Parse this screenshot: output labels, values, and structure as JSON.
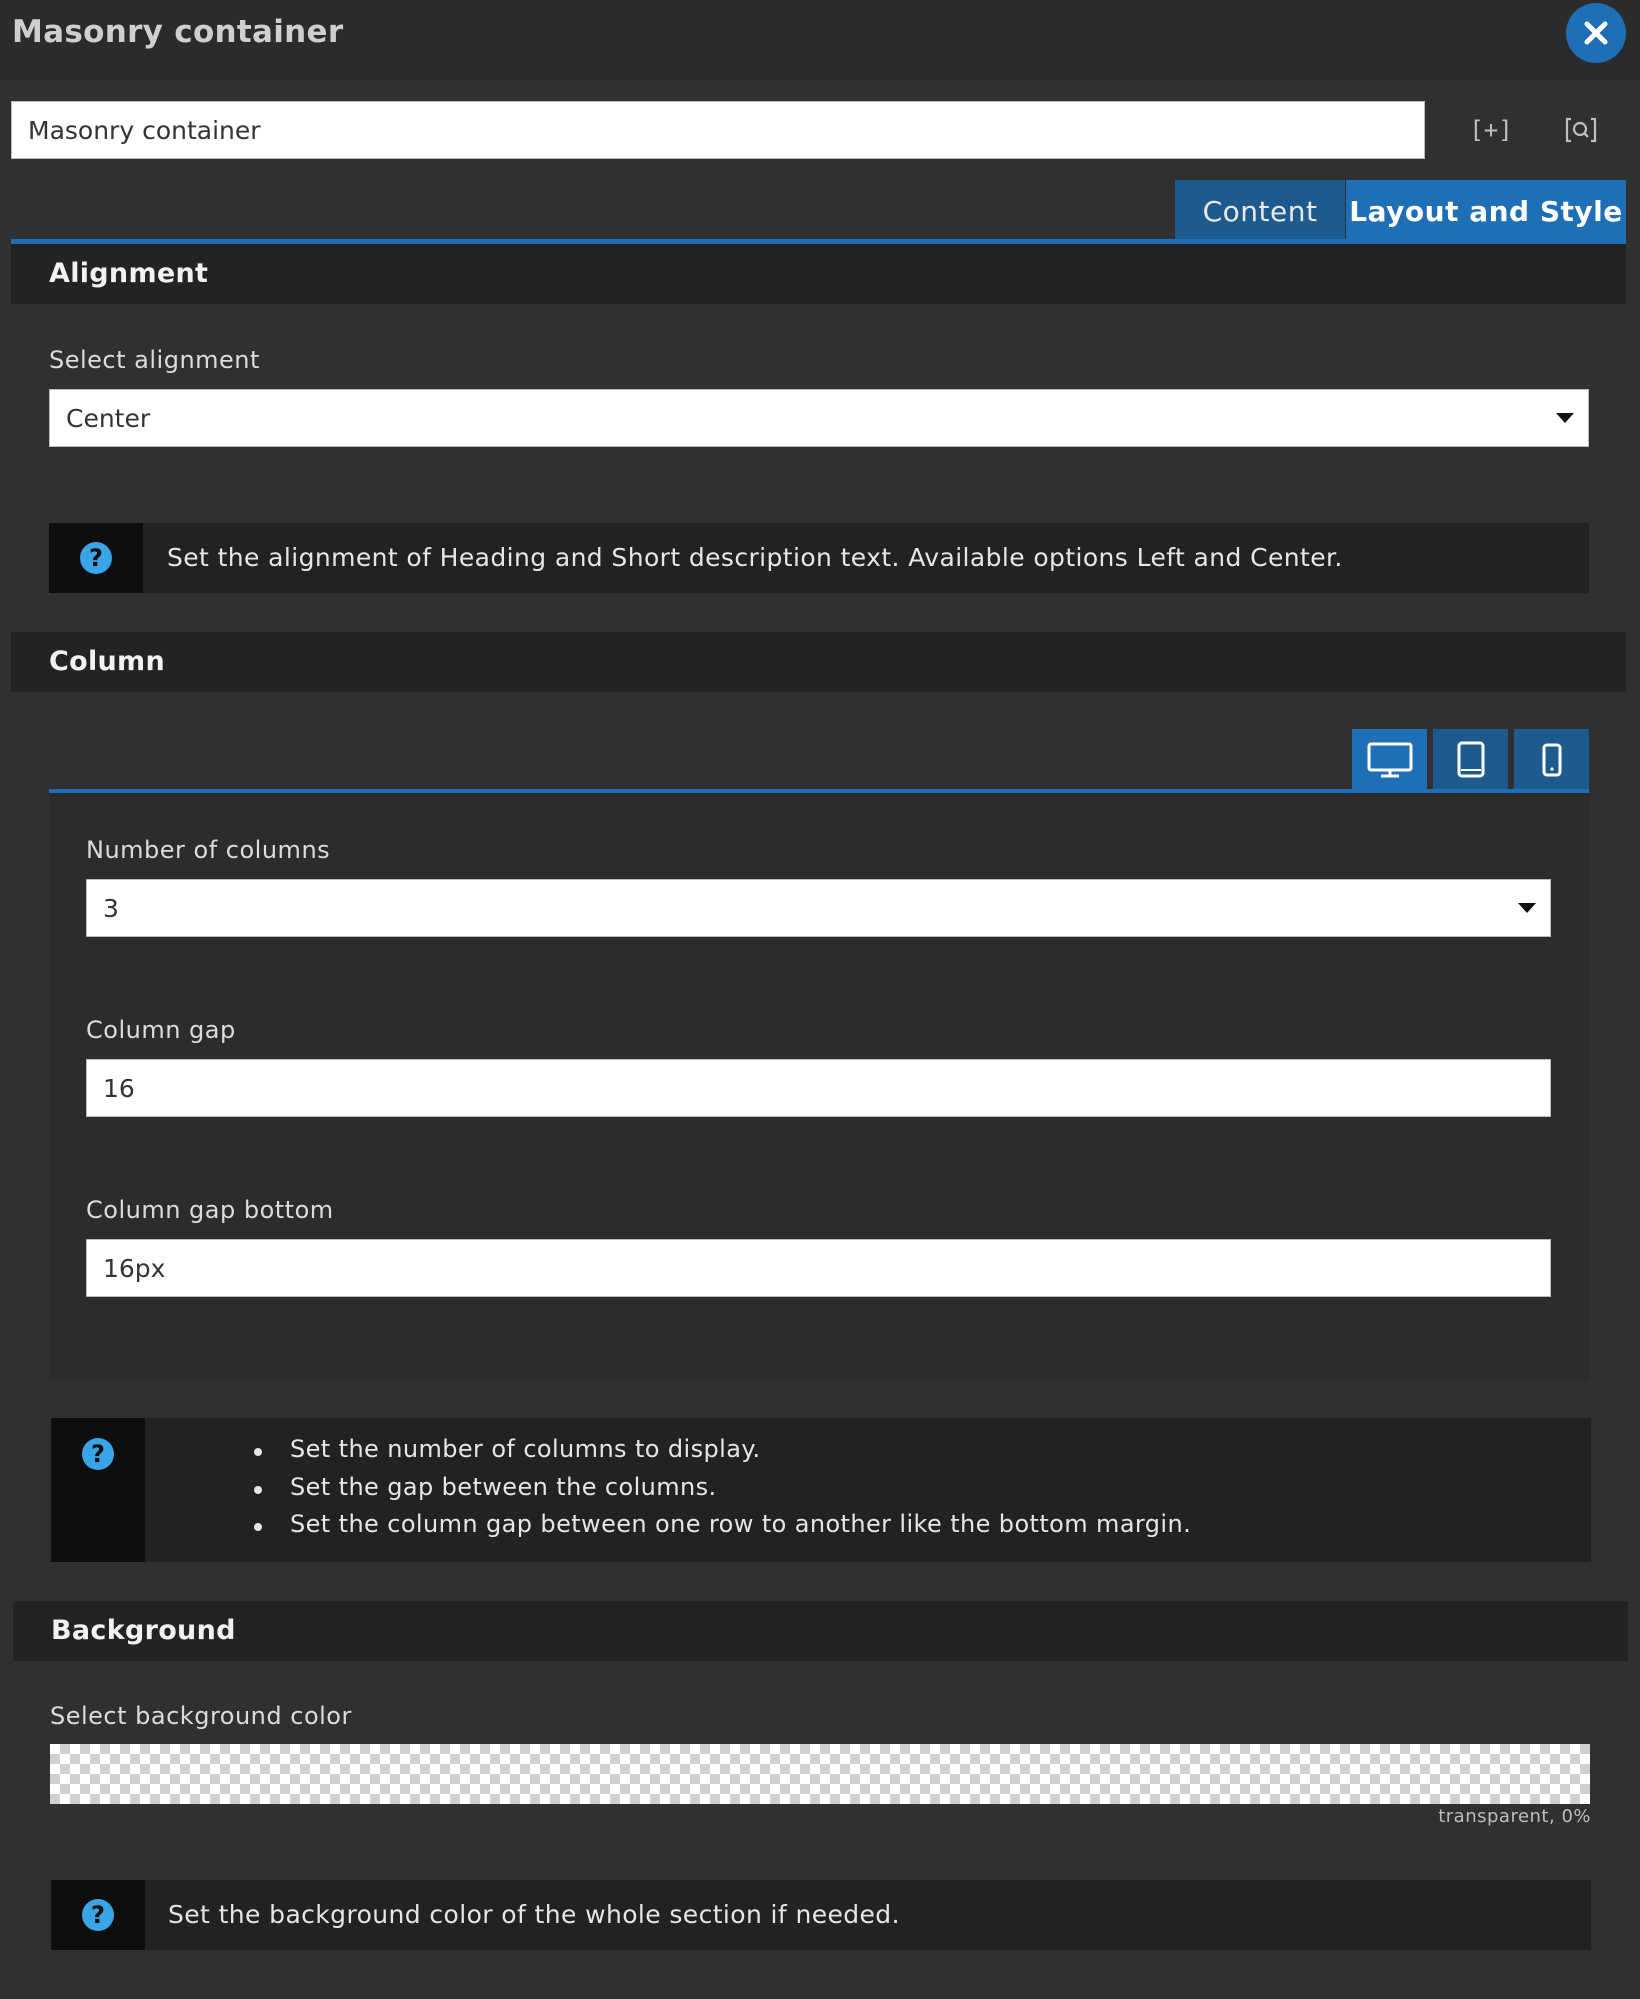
{
  "window": {
    "title": "Masonry container",
    "name_value": "Masonry container",
    "add_icon": "[+]",
    "search_icon": "[Q]"
  },
  "tabs": [
    {
      "label": "Content",
      "active": false
    },
    {
      "label": "Layout and Style",
      "active": true
    }
  ],
  "alignment": {
    "header": "Alignment",
    "select_label": "Select alignment",
    "select_value": "Center",
    "help": "Set the alignment of Heading and Short description text. Available options Left and Center."
  },
  "column": {
    "header": "Column",
    "devices": [
      "desktop-icon",
      "tablet-icon",
      "mobile-icon"
    ],
    "active_device": "desktop",
    "num_columns_label": "Number of columns",
    "num_columns_value": "3",
    "gap_label": "Column gap",
    "gap_value": "16",
    "gap_bottom_label": "Column gap bottom",
    "gap_bottom_value": "16px",
    "help": [
      "Set the number of columns to display.",
      "Set the gap between the columns.",
      "Set the column gap between one row to another like the bottom margin."
    ]
  },
  "background": {
    "header": "Background",
    "color_label": "Select background color",
    "color_caption": "transparent, 0%",
    "help": "Set the background color of the whole section if needed."
  },
  "colors": {
    "accent": "#1e6fb5",
    "help_icon": "#3aa5e6",
    "panel": "#303030",
    "header": "#232323"
  }
}
